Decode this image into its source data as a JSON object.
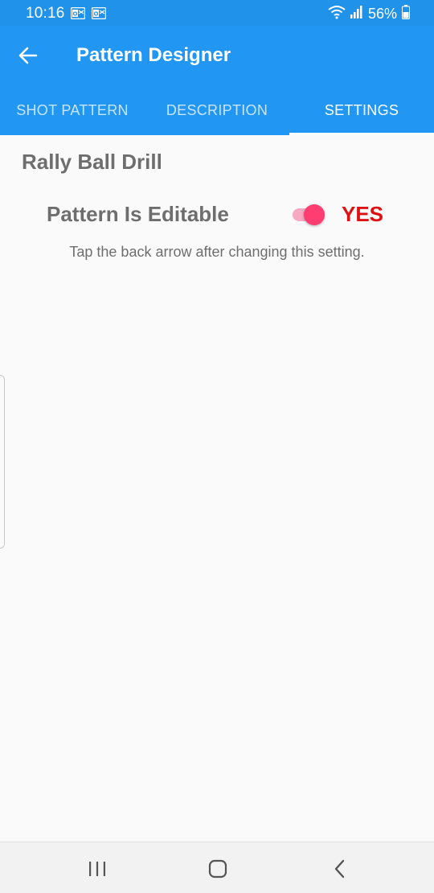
{
  "status_bar": {
    "time": "10:16",
    "battery_percent": "56%",
    "notification_icons": [
      "outlook-icon",
      "outlook-icon"
    ],
    "status_icons": [
      "wifi-icon",
      "signal-icon",
      "battery-icon"
    ]
  },
  "app_bar": {
    "title": "Pattern Designer",
    "back_icon": "arrow-left-icon",
    "background_color": "#2196f3"
  },
  "tabs": [
    {
      "label": "SHOT PATTERN",
      "active": false
    },
    {
      "label": "DESCRIPTION",
      "active": false
    },
    {
      "label": "SETTINGS",
      "active": true
    }
  ],
  "content": {
    "drill_name": "Rally Ball Drill",
    "setting": {
      "label": "Pattern Is Editable",
      "toggle_on": true,
      "state_text": "YES",
      "state_color": "#dd1111",
      "toggle_color": "#ff3d71"
    },
    "hint": "Tap the back arrow after changing this setting."
  },
  "nav_bar": {
    "buttons": [
      "recent-apps-icon",
      "home-icon",
      "back-icon"
    ]
  }
}
